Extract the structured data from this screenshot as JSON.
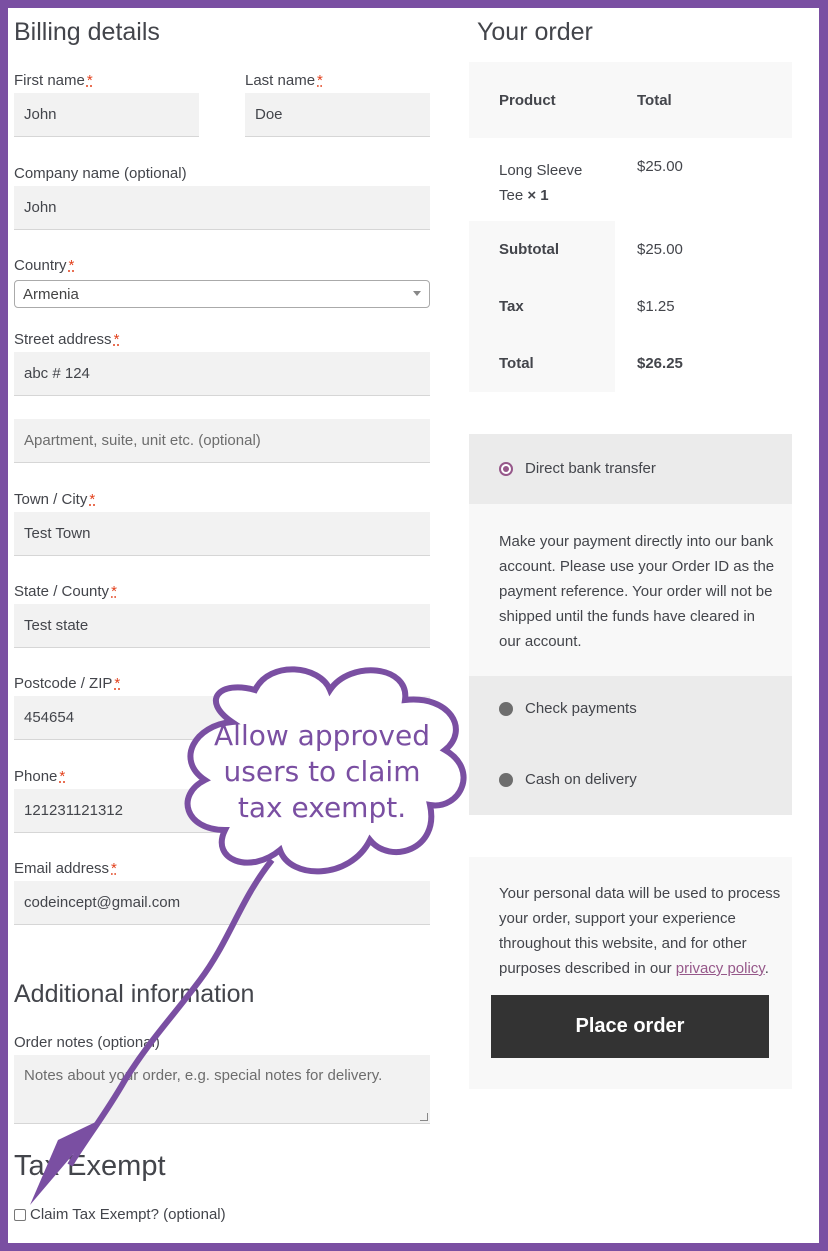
{
  "billing": {
    "title": "Billing details",
    "required_mark": "*",
    "first_name_label": "First name",
    "first_name_value": "John",
    "last_name_label": "Last name",
    "last_name_value": "Doe",
    "company_label": "Company name (optional)",
    "company_value": "John",
    "country_label": "Country",
    "country_value": "Armenia",
    "street_label": "Street address",
    "street_value": "abc # 124",
    "apartment_placeholder": "Apartment, suite, unit etc. (optional)",
    "town_label": "Town / City",
    "town_value": "Test Town",
    "state_label": "State / County",
    "state_value": "Test state",
    "postcode_label": "Postcode / ZIP",
    "postcode_value": "454654",
    "phone_label": "Phone",
    "phone_value": "121231121312",
    "email_label": "Email address",
    "email_value": "codeincept@gmail.com"
  },
  "additional": {
    "title": "Additional information",
    "notes_label": "Order notes (optional)",
    "notes_placeholder": "Notes about your order, e.g. special notes for delivery."
  },
  "tax_exempt": {
    "title": "Tax Exempt",
    "checkbox_label": "Claim Tax Exempt? (optional)"
  },
  "order": {
    "title": "Your order",
    "col_product": "Product",
    "col_total": "Total",
    "item_name_line1": "Long Sleeve",
    "item_name_line2": "Tee",
    "item_qty": "× 1",
    "item_total": "$25.00",
    "subtotal_label": "Subtotal",
    "subtotal_value": "$25.00",
    "tax_label": "Tax",
    "tax_value": "$1.25",
    "total_label": "Total",
    "total_value": "$26.25"
  },
  "payment": {
    "methods": [
      "Direct bank transfer",
      "Check payments",
      "Cash on delivery"
    ],
    "bank_desc_lines": [
      "Make your payment directly into our bank",
      "account. Please use your Order ID as the",
      "payment reference. Your order will not be",
      "shipped until the funds have cleared in",
      "our account."
    ],
    "privacy_lines": [
      "Your personal data will be used to process",
      "your order, support your experience",
      "throughout this website, and for other",
      "purposes described in our"
    ],
    "privacy_link": "privacy policy",
    "privacy_end": ".",
    "place_order": "Place order"
  },
  "annotation": {
    "lines": [
      "Allow approved",
      "users to claim",
      "tax exempt."
    ],
    "color": "#7a4fa2"
  }
}
